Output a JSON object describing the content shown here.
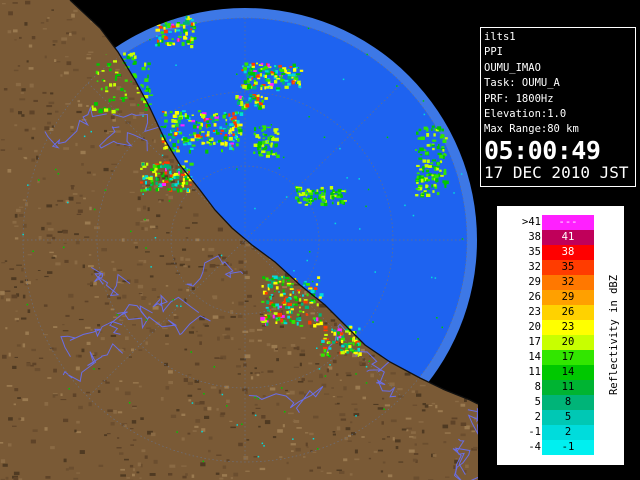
{
  "radar": {
    "colors": {
      "background": "#000000",
      "radar_outer": "#3d78e6",
      "radar_inner": "#1e63f0",
      "land": "#7a5a36",
      "river": "#6a6ee6",
      "coast": "#101010",
      "range_ring": "#6a7080"
    }
  },
  "info": {
    "site": "ilts1",
    "product": "PPI",
    "product_name": "OUMU_IMAO",
    "task": "Task: OUMU_A",
    "prf": "PRF: 1800Hz",
    "elevation": "Elevation:1.0",
    "max_range": "Max Range:80 km",
    "time": "05:00:49",
    "date": "17 DEC 2010 JST"
  },
  "legend": {
    "unit_label": "Reflectivity in dBZ",
    "rows": [
      {
        "low": ">41",
        "high": "---",
        "color": "#ff20ff"
      },
      {
        "low": "38",
        "high": "41",
        "color": "#c0005a"
      },
      {
        "low": "35",
        "high": "38",
        "color": "#ff0000"
      },
      {
        "low": "32",
        "high": "35",
        "color": "#ff3c00"
      },
      {
        "low": "29",
        "high": "32",
        "color": "#ff7800"
      },
      {
        "low": "26",
        "high": "29",
        "color": "#ffa000"
      },
      {
        "low": "23",
        "high": "26",
        "color": "#ffd200"
      },
      {
        "low": "20",
        "high": "23",
        "color": "#ffff00"
      },
      {
        "low": "17",
        "high": "20",
        "color": "#c8ff00"
      },
      {
        "low": "14",
        "high": "17",
        "color": "#32e600"
      },
      {
        "low": "11",
        "high": "14",
        "color": "#00c800"
      },
      {
        "low": "8",
        "high": "11",
        "color": "#00b432"
      },
      {
        "low": "5",
        "high": "8",
        "color": "#00b478"
      },
      {
        "low": "2",
        "high": "5",
        "color": "#00c8b4"
      },
      {
        "low": "-1",
        "high": "2",
        "color": "#00dcdc"
      },
      {
        "low": "-4",
        "high": "-1",
        "color": "#00f0f0"
      }
    ]
  }
}
